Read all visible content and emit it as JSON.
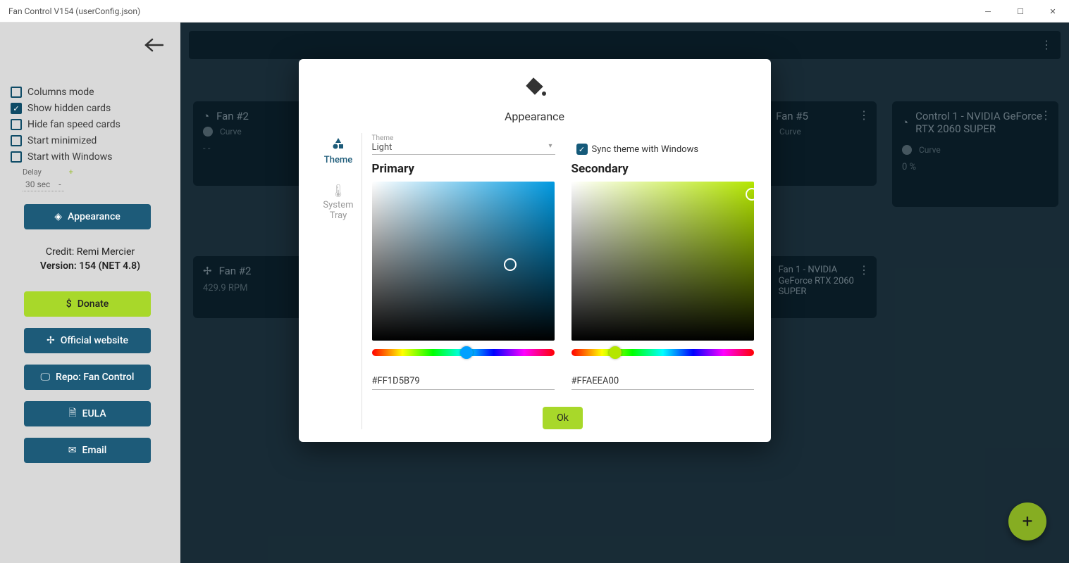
{
  "window": {
    "title": "Fan Control V154 (userConfig.json)"
  },
  "sidebar": {
    "options": {
      "columns_mode": {
        "label": "Columns mode",
        "checked": false
      },
      "show_hidden": {
        "label": "Show hidden cards",
        "checked": true
      },
      "hide_fan_speed": {
        "label": "Hide fan speed cards",
        "checked": false
      },
      "start_minimized": {
        "label": "Start minimized",
        "checked": false
      },
      "start_with_windows": {
        "label": "Start with Windows",
        "checked": false
      }
    },
    "delay_label": "Delay",
    "delay_value": "30 sec",
    "appearance_btn": "Appearance",
    "credit": "Credit: Remi Mercier",
    "version": "Version: 154 (NET 4.8)",
    "buttons": {
      "donate": "Donate",
      "official": "Official website",
      "repo": "Repo: Fan Control",
      "eula": "EULA",
      "email": "Email"
    }
  },
  "cards": {
    "fan2": {
      "title": "Fan #2",
      "curve": "Curve"
    },
    "fan5": {
      "title": "Fan #5",
      "curve": "Curve"
    },
    "control1": {
      "title": "Control 1 - NVIDIA GeForce RTX 2060 SUPER",
      "curve": "Curve",
      "percent": "0 %"
    },
    "fan2_rpm": {
      "title": "Fan #2",
      "rpm": "429.9 RPM"
    },
    "fan1_nvidia": {
      "title": "Fan 1 - NVIDIA GeForce RTX 2060 SUPER"
    }
  },
  "modal": {
    "title": "Appearance",
    "tabs": {
      "theme": "Theme",
      "system_tray": "System Tray"
    },
    "theme_select": {
      "label": "Theme",
      "value": "Light"
    },
    "sync_label": "Sync theme with Windows",
    "sync_checked": true,
    "primary_label": "Primary",
    "secondary_label": "Secondary",
    "primary_hex": "#FF1D5B79",
    "secondary_hex": "#FFAEEA00",
    "ok": "Ok"
  }
}
